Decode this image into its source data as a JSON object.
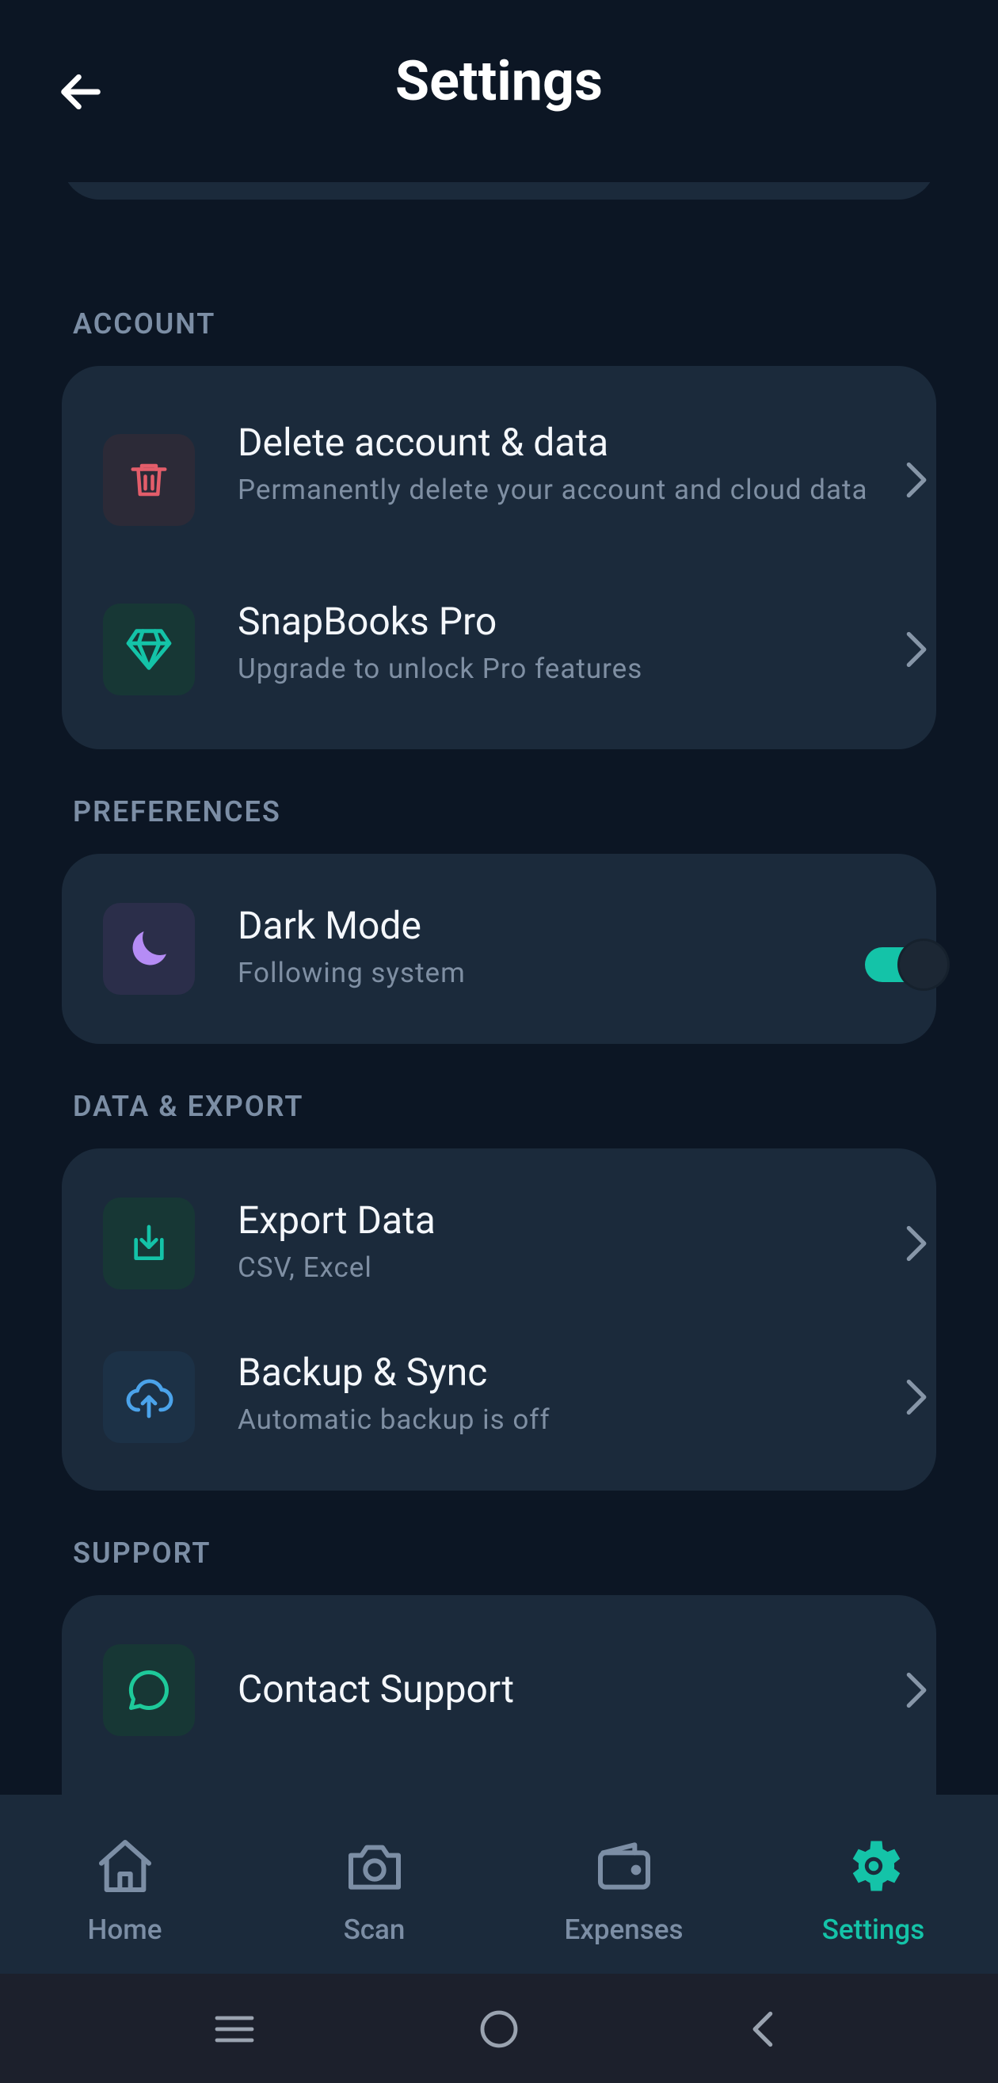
{
  "header": {
    "title": "Settings",
    "back_icon": "arrow-left-icon"
  },
  "sections": {
    "account": {
      "title": "ACCOUNT",
      "items": [
        {
          "title": "Delete account & data",
          "subtitle": "Permanently delete your account and cloud data",
          "icon": "trash-icon",
          "icon_color": "#e35d6a"
        },
        {
          "title": "SnapBooks Pro",
          "subtitle": "Upgrade to unlock Pro features",
          "icon": "diamond-icon",
          "icon_color": "#14c3a8"
        }
      ]
    },
    "preferences": {
      "title": "PREFERENCES",
      "items": [
        {
          "title": "Dark Mode",
          "subtitle": "Following system",
          "icon": "moon-icon",
          "icon_color": "#b58cf5",
          "toggle_on": true
        }
      ]
    },
    "data_export": {
      "title": "DATA & EXPORT",
      "items": [
        {
          "title": "Export Data",
          "subtitle": "CSV, Excel",
          "icon": "download-icon",
          "icon_color": "#14c3a8"
        },
        {
          "title": "Backup & Sync",
          "subtitle": "Automatic backup is off",
          "icon": "cloud-upload-icon",
          "icon_color": "#4ba3ea"
        }
      ]
    },
    "support": {
      "title": "SUPPORT",
      "items": [
        {
          "title": "Contact Support",
          "icon": "chat-bubble-icon",
          "icon_color": "#1ec99a"
        }
      ]
    }
  },
  "bottom_nav": {
    "items": [
      {
        "label": "Home",
        "icon": "home-icon",
        "active": false
      },
      {
        "label": "Scan",
        "icon": "camera-icon",
        "active": false
      },
      {
        "label": "Expenses",
        "icon": "wallet-icon",
        "active": false
      },
      {
        "label": "Settings",
        "icon": "gear-icon",
        "active": true
      }
    ]
  },
  "system_nav": {
    "buttons": [
      "menu-icon",
      "home-circle-icon",
      "back-chevron-icon"
    ]
  },
  "colors": {
    "background": "#0c1624",
    "card": "#1b2a3b",
    "accent": "#14c3a8",
    "muted_text": "#7c8ea5",
    "danger": "#e35d6a"
  }
}
